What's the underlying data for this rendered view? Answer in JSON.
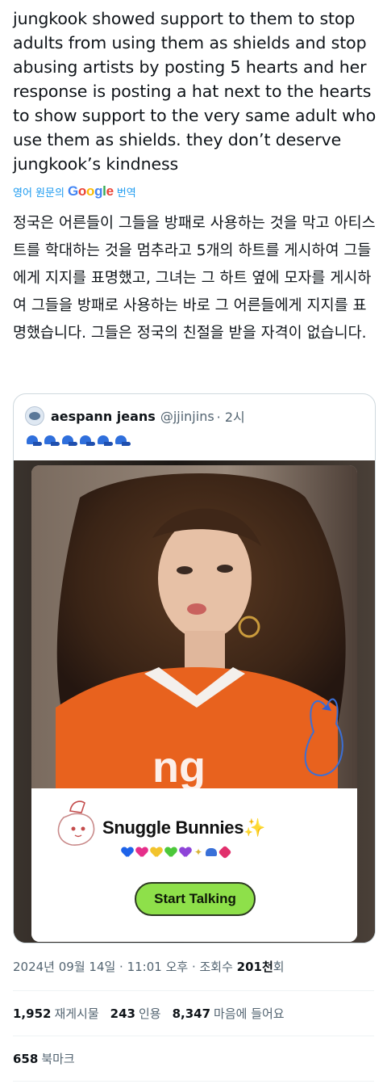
{
  "tweet": {
    "text": "jungkook showed support to them to stop adults from using them as shields and stop abusing artists by posting 5 hearts and her response is posting a hat next to the hearts to show support to the very same adult who use them as shields. they don’t deserve jungkook’s kindness",
    "translate_prefix": "영어 원문의",
    "translate_provider": "Google",
    "translate_suffix": "번역",
    "translated_text": "정국은 어른들이 그들을 방패로 사용하는 것을 막고 아티스트를 학대하는 것을 멈추라고 5개의 하트를 게시하여 그들에게 지지를 표명했고, 그녀는 그 하트 옆에 모자를 게시하여 그들을 방패로 사용하는 바로 그 어른들에게 지지를 표명했습니다. 그들은 정국의 친절을 받을 자격이 없습니다."
  },
  "quote": {
    "author_name": "aespann jeans",
    "author_handle": "@jjinjins",
    "time": "· 2시",
    "hat_count": 6,
    "card_title": "Snuggle Bunnies",
    "card_title_sparkle": "✨",
    "card_emoji_hearts": [
      "#1e63e9",
      "#e52e8a",
      "#f2c32c",
      "#4cc83a",
      "#8e44d8"
    ],
    "button_label": "Start Talking"
  },
  "meta": {
    "timestamp": "2024년 09월 14일 · 11:01 오후 · 조회수 ",
    "views": "201천",
    "views_suffix": "회"
  },
  "stats": {
    "retweets_count": "1,952",
    "retweets_label": "재게시물",
    "quotes_count": "243",
    "quotes_label": "인용",
    "likes_count": "8,347",
    "likes_label": "마음에 들어요",
    "bookmarks_count": "658",
    "bookmarks_label": "북마크"
  },
  "colors": {
    "link_blue": "#1d9bf0",
    "button_green": "#8ee04a",
    "muted": "#536471"
  }
}
